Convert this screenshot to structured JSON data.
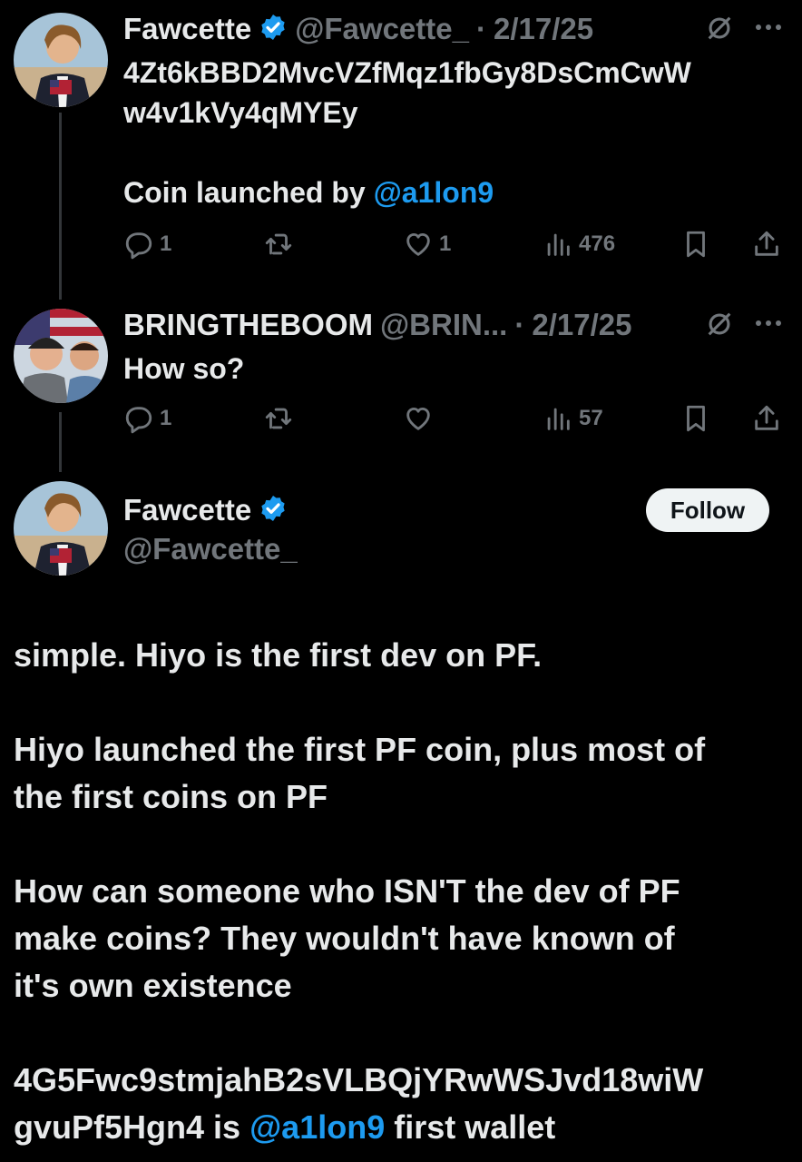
{
  "tweet1": {
    "name": "Fawcette",
    "handle": "@Fawcette_",
    "sep": "·",
    "date": "2/17/25",
    "text_line1": "4Zt6kBBD2MvcVZfMqz1fbGy8DsCmCwW",
    "text_line2": "w4v1kVy4qMYEy",
    "text_line3_prefix": "Coin launched by ",
    "mention": "@a1lon9",
    "replies": "1",
    "retweets": "",
    "likes": "1",
    "views": "476"
  },
  "tweet2": {
    "name": "BRINGTHEBOOM",
    "handle": "@BRIN...",
    "sep": "·",
    "date": "2/17/25",
    "text": "How so?",
    "replies": "1",
    "retweets": "",
    "likes": "",
    "views": "57"
  },
  "main": {
    "name": "Fawcette",
    "handle": "@Fawcette_",
    "follow_label": "Follow",
    "p1": "simple. Hiyo is the first dev on PF.",
    "p2_l1": "Hiyo launched the first PF coin, plus most of",
    "p2_l2": "the first coins on PF",
    "p3_l1": "How can someone who ISN'T the dev of PF",
    "p3_l2": "make coins? They wouldn't have known of",
    "p3_l3": "it's own existence",
    "p4_l1": "4G5Fwc9stmjahB2sVLBQjYRwWSJvd18wiW",
    "p4_l2_prefix": "gvuPf5Hgn4 is ",
    "p4_mention": "@a1lon9",
    "p4_l2_suffix": " first wallet"
  },
  "colors": {
    "background": "#000000",
    "text": "#e7e9ea",
    "muted": "#71767b",
    "accent": "#1d9bf0",
    "follow_bg": "#eff3f4"
  },
  "icons": [
    "verified-icon",
    "grok-icon",
    "more-icon",
    "reply-icon",
    "retweet-icon",
    "like-icon",
    "views-icon",
    "bookmark-icon",
    "share-icon"
  ]
}
